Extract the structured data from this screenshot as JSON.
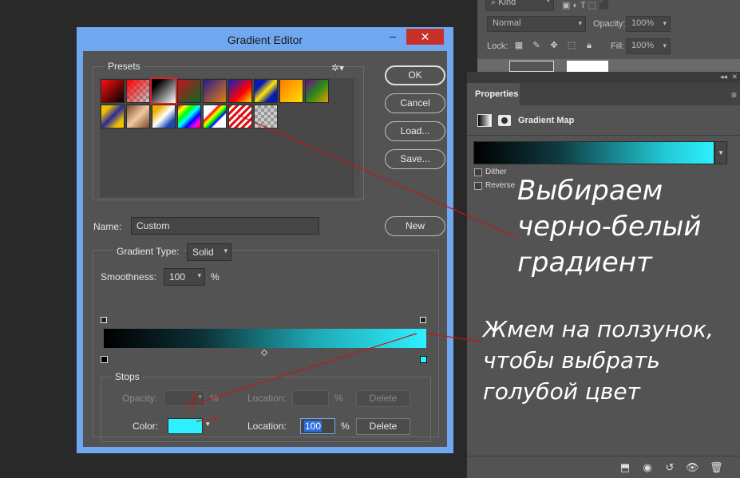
{
  "layers_panel": {
    "kind_label": "Kind",
    "blend_mode": "Normal",
    "opacity_label": "Opacity:",
    "opacity_value": "100%",
    "lock_label": "Lock:",
    "fill_label": "Fill:",
    "fill_value": "100%"
  },
  "properties_panel": {
    "tab_label": "Properties",
    "adjustment_title": "Gradient Map",
    "dither_label": "Dither",
    "reverse_label": "Reverse",
    "gradient_colors": [
      "#000000",
      "#2ef0ff"
    ]
  },
  "gradient_editor": {
    "title": "Gradient Editor",
    "presets_label": "Presets",
    "buttons": {
      "ok": "OK",
      "cancel": "Cancel",
      "load": "Load...",
      "save": "Save...",
      "new": "New"
    },
    "name_label": "Name:",
    "name_value": "Custom",
    "gradient_type_label": "Gradient Type:",
    "gradient_type_value": "Solid",
    "smoothness_label": "Smoothness:",
    "smoothness_value": "100",
    "percent": "%",
    "stops_label": "Stops",
    "opacity_label": "Opacity:",
    "location_label": "Location:",
    "color_label": "Color:",
    "color_location_value": "100",
    "delete_label": "Delete",
    "stop_color": "#2ef0ff"
  },
  "annotations": {
    "line1": "Выбираем",
    "line2": "черно-белый",
    "line3": "градиент",
    "line4": "Жмем на ползунок,",
    "line5": "чтобы выбрать",
    "line6": "голубой цвет"
  }
}
